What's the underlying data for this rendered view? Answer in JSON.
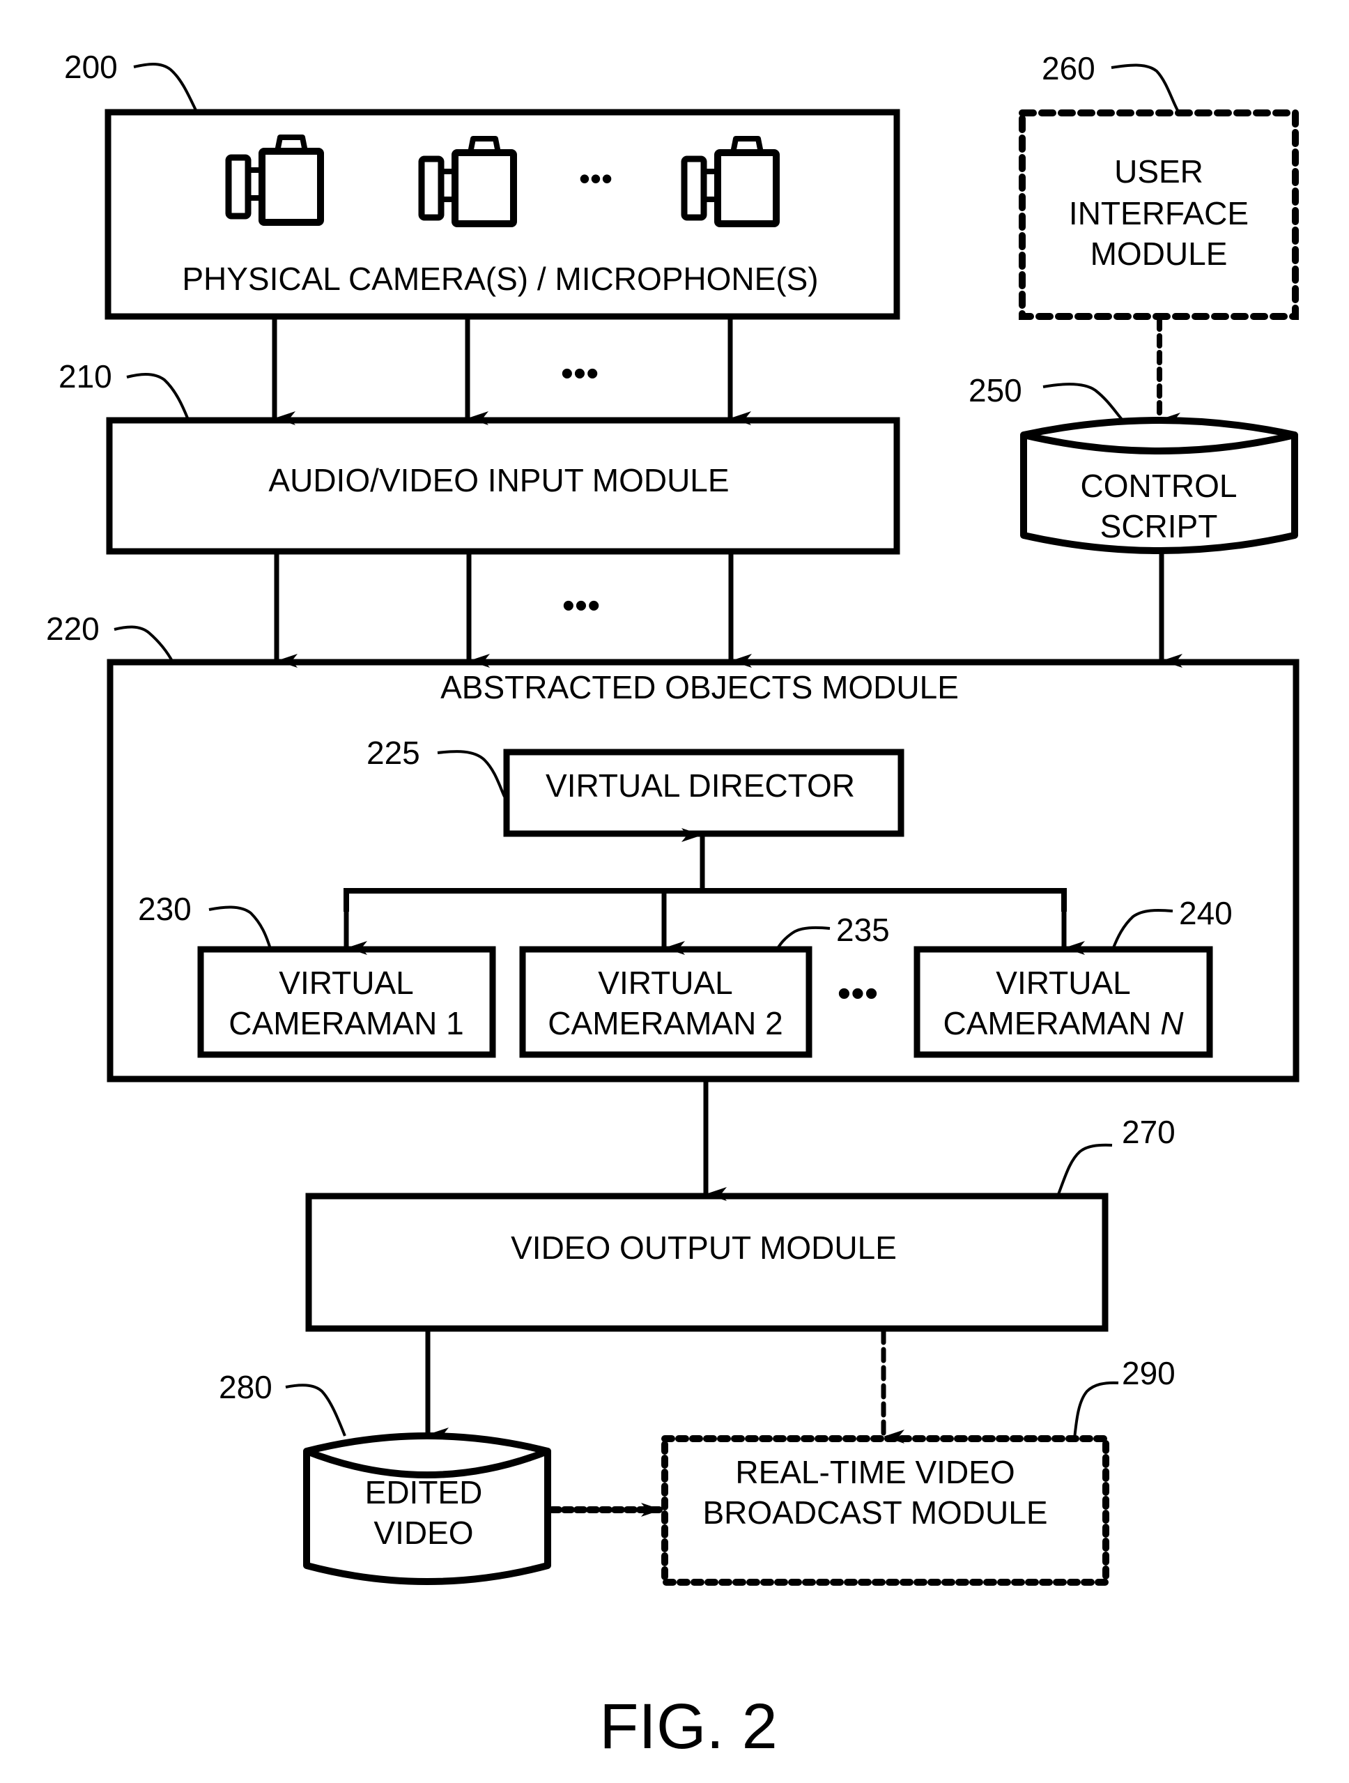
{
  "figure": {
    "caption": "FIG. 2"
  },
  "nodes": {
    "physical_cameras": {
      "ref": "200",
      "label": "PHYSICAL CAMERA(S) / MICROPHONE(S)",
      "style": "solid",
      "icon": "video-camera-icon",
      "icon_count": 3,
      "ellipsis": "•••"
    },
    "av_input": {
      "ref": "210",
      "label": "AUDIO/VIDEO INPUT MODULE",
      "style": "solid"
    },
    "abstracted_objects": {
      "ref": "220",
      "label": "ABSTRACTED OBJECTS MODULE",
      "style": "solid"
    },
    "virtual_director": {
      "ref": "225",
      "label": "VIRTUAL DIRECTOR",
      "style": "solid"
    },
    "virtual_cameraman_1": {
      "ref": "230",
      "label_line1": "VIRTUAL",
      "label_line2": "CAMERAMAN 1",
      "style": "solid"
    },
    "virtual_cameraman_2": {
      "ref": "235",
      "label_line1": "VIRTUAL",
      "label_line2": "CAMERAMAN 2",
      "style": "solid"
    },
    "virtual_cameraman_n": {
      "ref": "240",
      "label_line1": "VIRTUAL",
      "label_line2_prefix": "CAMERAMAN ",
      "label_line2_var": "N",
      "style": "solid"
    },
    "control_script": {
      "ref": "250",
      "label_line1": "CONTROL",
      "label_line2": "SCRIPT",
      "shape": "cylinder"
    },
    "user_interface": {
      "ref": "260",
      "label_line1": "USER",
      "label_line2": "INTERFACE",
      "label_line3": "MODULE",
      "style": "dashed"
    },
    "video_output": {
      "ref": "270",
      "label": "VIDEO OUTPUT MODULE",
      "style": "solid"
    },
    "edited_video": {
      "ref": "280",
      "label_line1": "EDITED",
      "label_line2": "VIDEO",
      "shape": "cylinder"
    },
    "realtime_broadcast": {
      "ref": "290",
      "label_line1": "REAL-TIME VIDEO",
      "label_line2": "BROADCAST MODULE",
      "style": "dashed"
    }
  },
  "edges": [
    {
      "from": "physical_cameras",
      "to": "av_input",
      "style": "solid",
      "count": "multiple"
    },
    {
      "from": "av_input",
      "to": "abstracted_objects",
      "style": "solid",
      "count": "multiple"
    },
    {
      "from": "user_interface",
      "to": "control_script",
      "style": "dashed"
    },
    {
      "from": "control_script",
      "to": "abstracted_objects",
      "style": "solid"
    },
    {
      "from": "virtual_cameraman_bus",
      "to": "virtual_director",
      "style": "solid"
    },
    {
      "from": "virtual_director_bus",
      "to": "virtual_cameraman_1",
      "style": "solid"
    },
    {
      "from": "virtual_director_bus",
      "to": "virtual_cameraman_2",
      "style": "solid"
    },
    {
      "from": "virtual_director_bus",
      "to": "virtual_cameraman_n",
      "style": "solid"
    },
    {
      "from": "abstracted_objects",
      "to": "video_output",
      "style": "solid"
    },
    {
      "from": "video_output",
      "to": "edited_video",
      "style": "solid"
    },
    {
      "from": "video_output",
      "to": "realtime_broadcast",
      "style": "dashed"
    },
    {
      "from": "edited_video",
      "to": "realtime_broadcast",
      "style": "dotted"
    }
  ],
  "ellipsis": "•••"
}
